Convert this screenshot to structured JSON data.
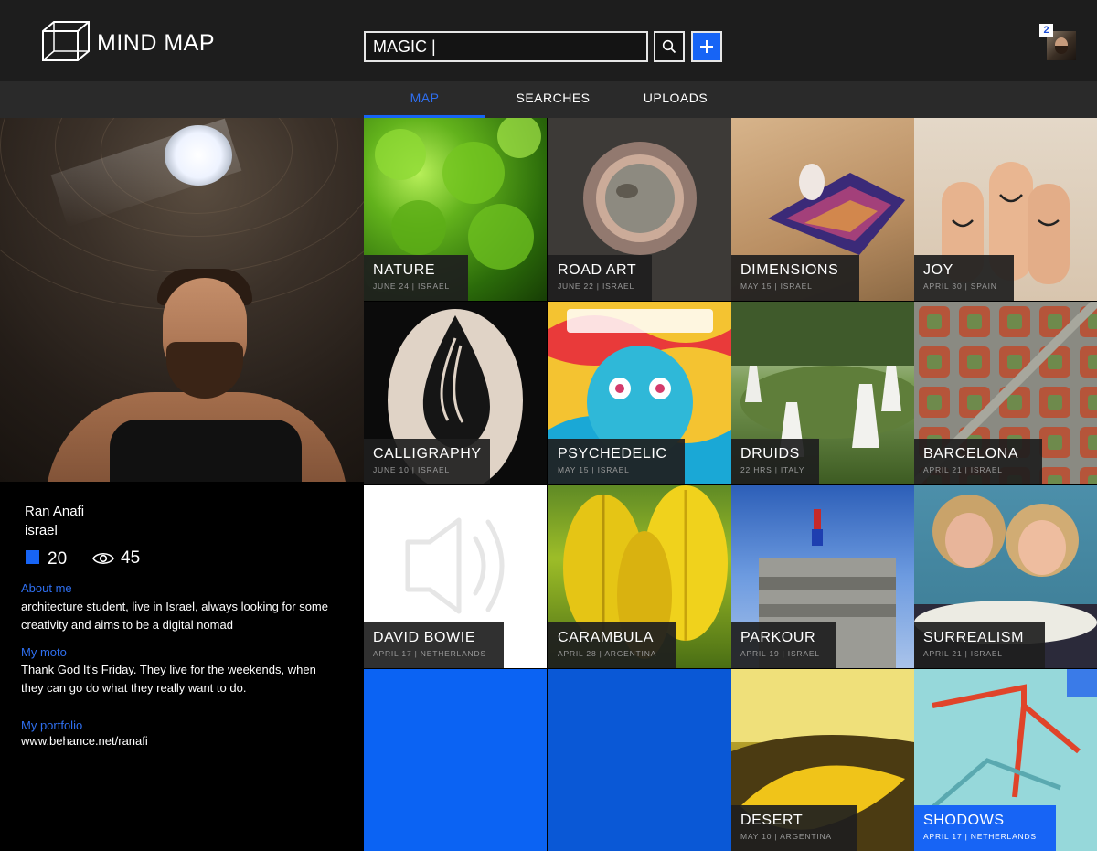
{
  "header": {
    "brand": "MIND MAP",
    "search_value": "MAGIC |",
    "notification_count": "2"
  },
  "tabs": [
    {
      "label": "MAP",
      "active": true
    },
    {
      "label": "SEARCHES",
      "active": false
    },
    {
      "label": "UPLOADS",
      "active": false
    }
  ],
  "profile": {
    "name": "Ran Anafi",
    "location": "israel",
    "stat_boards": "20",
    "stat_views": "45",
    "about_title": "About me",
    "about_text": "architecture student, live in Israel, always looking for some creativity and aims to be a digital nomad",
    "moto_title": "My moto",
    "moto_text": "Thank God It's Friday. They live for the weekends, when they can go do what they really want to do.",
    "portfolio_title": "My portfolio",
    "portfolio_url": "www.behance.net/ranafi"
  },
  "tiles": [
    {
      "title": "NATURE",
      "sub": "JUNE 24 | ISRAEL"
    },
    {
      "title": "ROAD ART",
      "sub": "JUNE 22 | ISRAEL"
    },
    {
      "title": "DIMENSIONS",
      "sub": "MAY 15 | ISRAEL"
    },
    {
      "title": "JOY",
      "sub": "APRIL 30 | SPAIN"
    },
    {
      "title": "CALLIGRAPHY",
      "sub": "JUNE 10 | ISRAEL"
    },
    {
      "title": "PSYCHEDELIC",
      "sub": "MAY 15 | ISRAEL"
    },
    {
      "title": "DRUIDS",
      "sub": "22 HRS | ITALY"
    },
    {
      "title": "BARCELONA",
      "sub": "APRIL 21 | ISRAEL"
    },
    {
      "title": "DAVID BOWIE",
      "sub": "APRIL 17 | NETHERLANDS"
    },
    {
      "title": "CARAMBULA",
      "sub": "APRIL 28 | ARGENTINA"
    },
    {
      "title": "PARKOUR",
      "sub": "APRIL 19 | ISRAEL"
    },
    {
      "title": "SURREALISM",
      "sub": "APRIL 21 | ISRAEL"
    },
    {
      "title": "DESERT",
      "sub": "MAY 10 | ARGENTINA"
    },
    {
      "title": "SHODOWS",
      "sub": "APRIL 17 | NETHERLANDS"
    }
  ],
  "colors": {
    "accent": "#1764f5",
    "header_bg": "#1d1d1d",
    "tabbar_bg": "#2a2a2a"
  }
}
